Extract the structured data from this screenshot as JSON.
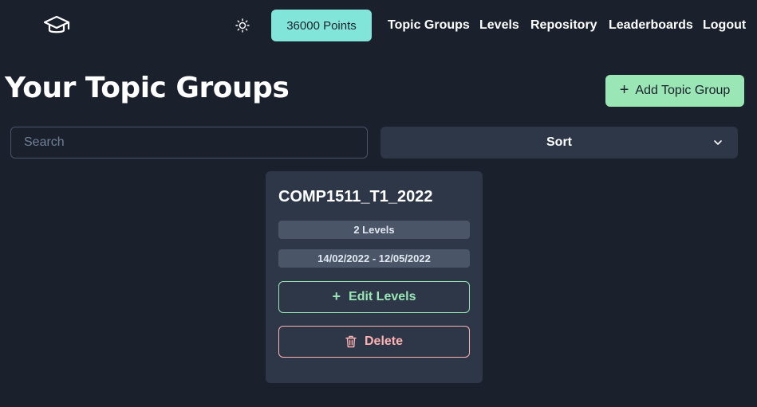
{
  "navbar": {
    "logo_icon": "graduation-cap-icon",
    "theme_icon": "sun-icon",
    "points_label": "36000 Points",
    "links": [
      {
        "label": "Topic Groups"
      },
      {
        "label": "Levels"
      },
      {
        "label": "Repository"
      },
      {
        "label": "Leaderboards"
      },
      {
        "label": "Logout"
      }
    ]
  },
  "page": {
    "title": "Your Topic Groups",
    "add_button_label": "Add Topic Group"
  },
  "filters": {
    "search_placeholder": "Search",
    "search_value": "",
    "sort_label": "Sort"
  },
  "topic_groups": [
    {
      "name": "COMP1511_T1_2022",
      "levels_badge": "2 Levels",
      "date_range": "14/02/2022 - 12/05/2022",
      "edit_label": "Edit Levels",
      "delete_label": "Delete"
    }
  ],
  "colors": {
    "background": "#1a202c",
    "card": "#2d3748",
    "points_accent": "#81e6d9",
    "add_button": "#9ae6b4",
    "edit_accent": "#9ae6b4",
    "delete_accent": "#feb2b2"
  }
}
